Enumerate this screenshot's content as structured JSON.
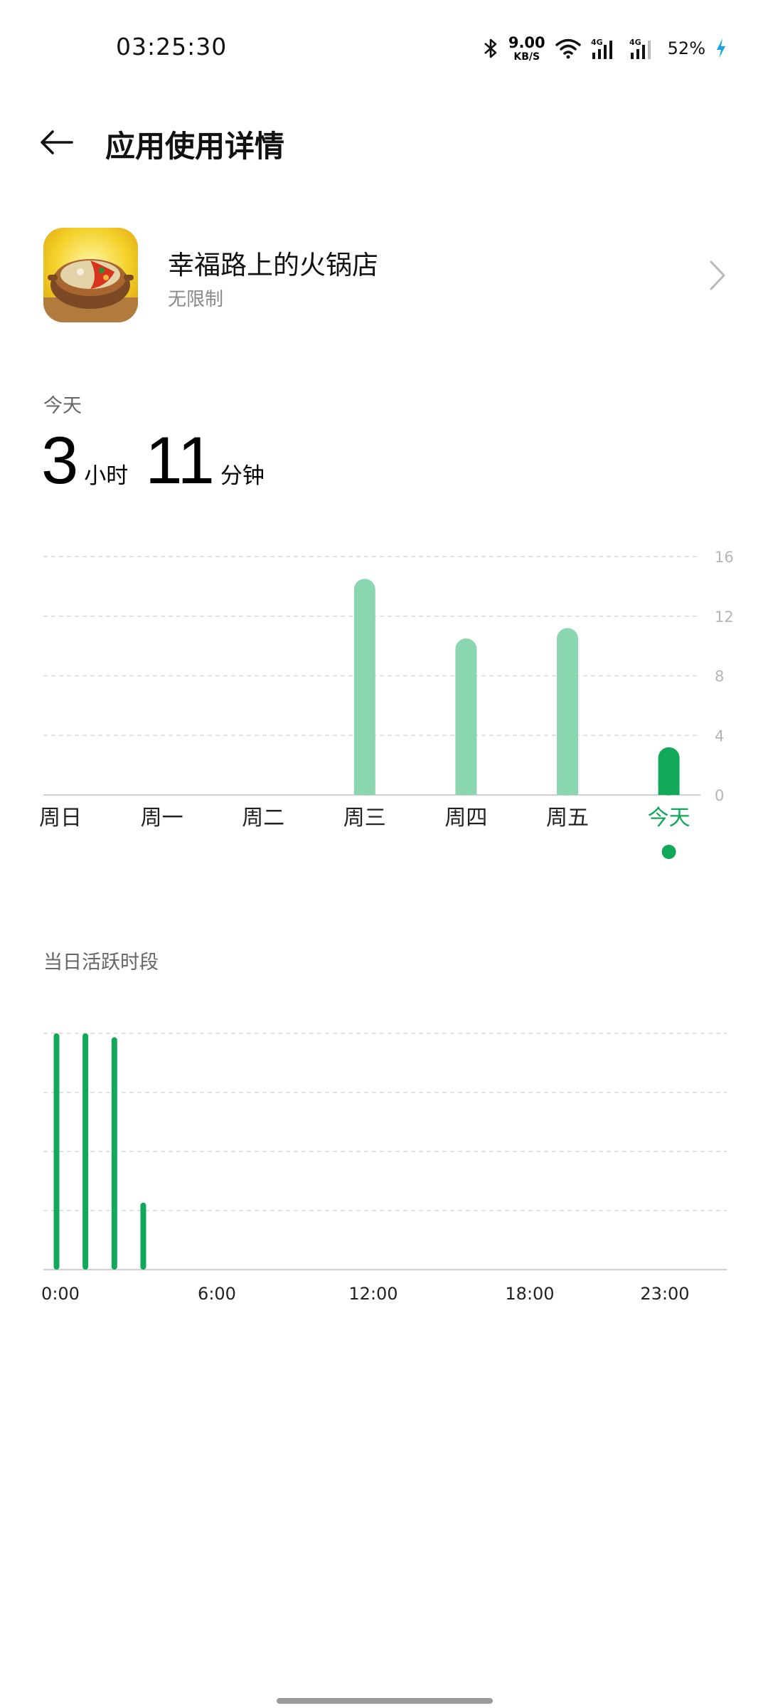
{
  "status_bar": {
    "time": "03:25:30",
    "net_speed_value": "9.00",
    "net_speed_unit": "KB/S",
    "signal1_label": "4G",
    "signal2_label": "4G",
    "battery": "52%"
  },
  "header": {
    "title": "应用使用详情",
    "back_icon": "arrow-left-icon"
  },
  "app": {
    "name": "幸福路上的火锅店",
    "restriction": "无限制",
    "icon": "hotpot-app-icon"
  },
  "today": {
    "label": "今天",
    "hours": "3",
    "hours_unit": "小时",
    "minutes": "11",
    "minutes_unit": "分钟"
  },
  "active_section": {
    "label": "当日活跃时段"
  },
  "colors": {
    "bar_light": "#8ad6b0",
    "bar_active": "#12a85a",
    "grid": "#d9d9d9",
    "axis_text": "#b5b5b5"
  },
  "chart_data": [
    {
      "type": "bar",
      "categories": [
        "周日",
        "周一",
        "周二",
        "周三",
        "周四",
        "周五",
        "今天"
      ],
      "values": [
        0,
        0,
        0,
        14.5,
        10.5,
        11.2,
        3.2
      ],
      "selected_index": 6,
      "yticks": [
        "16",
        "12",
        "8",
        "4",
        "0"
      ],
      "ylim": [
        0,
        16
      ],
      "grid": true
    },
    {
      "type": "bar",
      "xticks": [
        "0:00",
        "6:00",
        "12:00",
        "18:00",
        "23:00"
      ],
      "x": [
        0.5,
        1.6,
        2.7,
        3.8
      ],
      "values": [
        60,
        60,
        59,
        17
      ],
      "ylim": [
        0,
        60
      ],
      "xlim": [
        0,
        26
      ],
      "grid": true
    }
  ]
}
